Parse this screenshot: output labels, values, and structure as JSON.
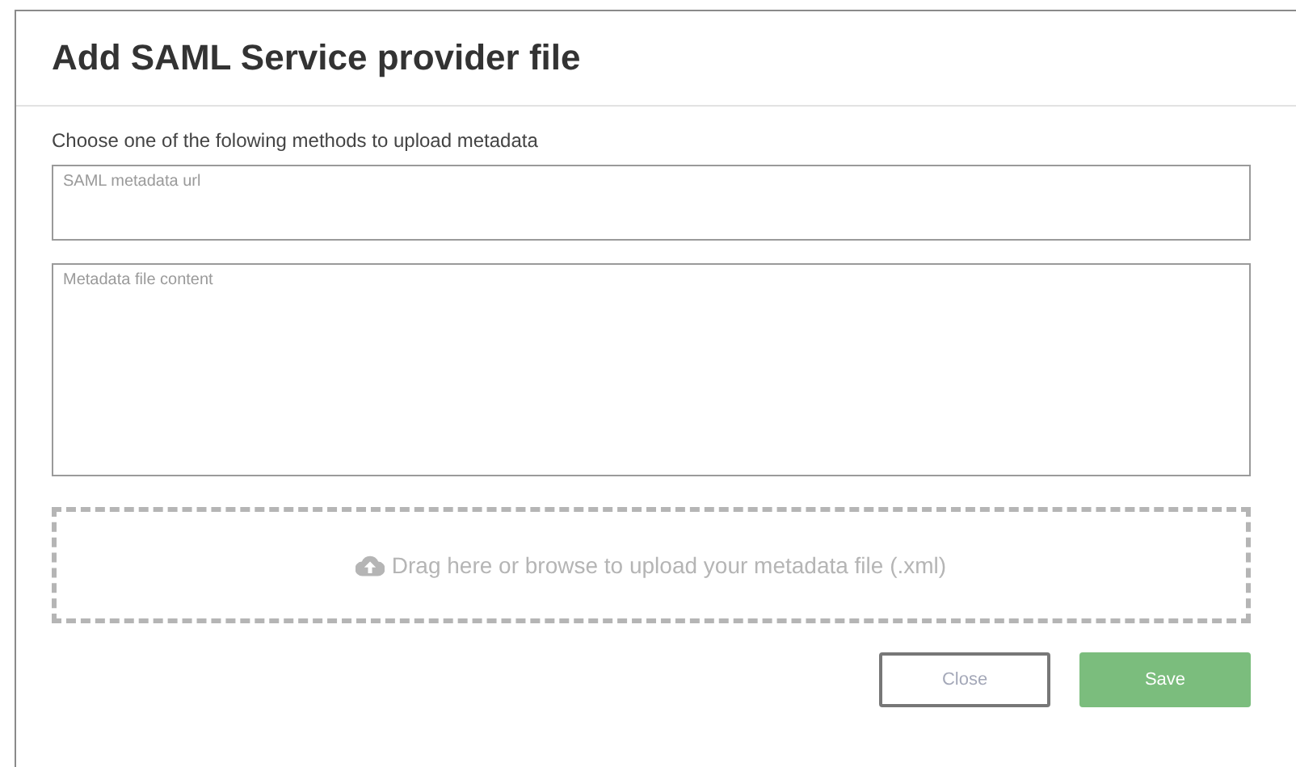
{
  "dialog": {
    "title": "Add SAML Service provider file"
  },
  "instructions": "Choose one of the folowing methods to upload metadata",
  "fields": [
    {
      "kind": "line",
      "placeholder": "SAML metadata url"
    },
    {
      "kind": "area",
      "placeholder": "Metadata file content"
    }
  ],
  "dropzone": {
    "label": "Drag here or browse to upload your metadata file (.xml)"
  },
  "buttons": [
    {
      "kind": "secondary",
      "label": "Close"
    },
    {
      "kind": "primary",
      "label": "Save"
    }
  ]
}
